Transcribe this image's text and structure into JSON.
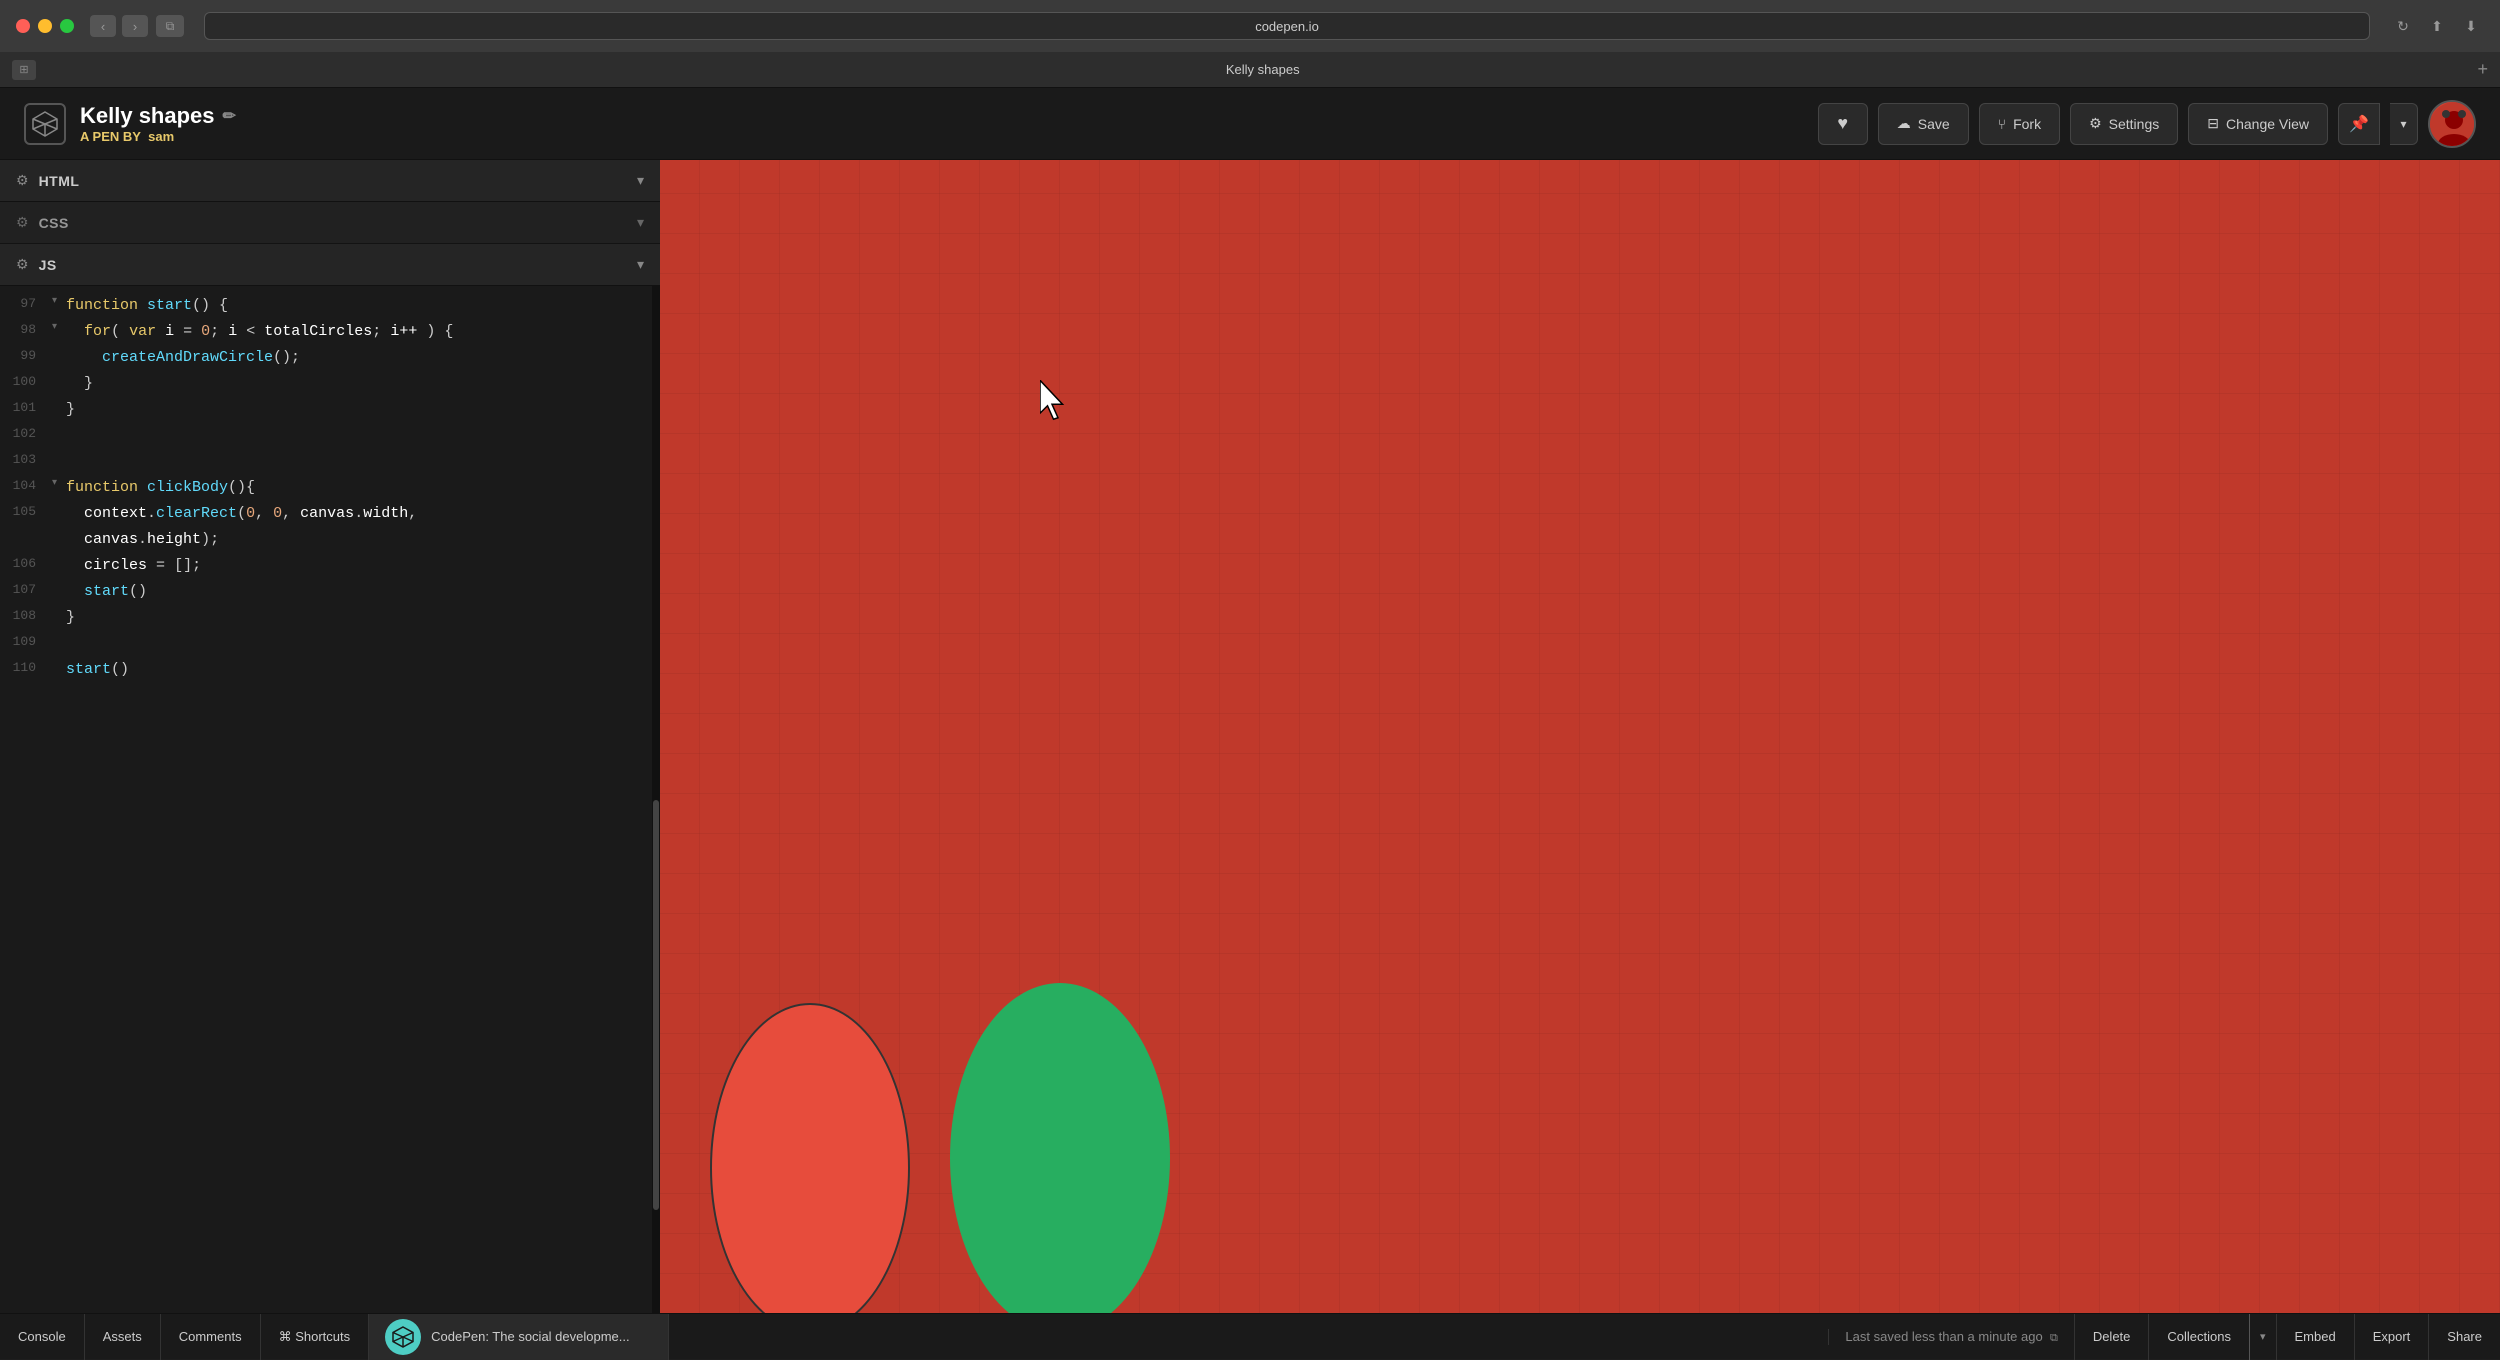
{
  "titlebar": {
    "url": "codepen.io",
    "tab_title": "Kelly shapes"
  },
  "header": {
    "pen_title": "Kelly shapes",
    "pen_subtitle": "A PEN BY",
    "pen_author": "sam",
    "heart_label": "♥",
    "save_label": "Save",
    "fork_label": "Fork",
    "settings_label": "Settings",
    "change_view_label": "Change View"
  },
  "editor": {
    "html_label": "HTML",
    "css_label": "CSS",
    "js_label": "JS",
    "lines": [
      {
        "num": "97",
        "content": "function start() {",
        "fold": "▾"
      },
      {
        "num": "98",
        "content": "  for( var i = 0; i < totalCircles; i++ ) {",
        "fold": "▾"
      },
      {
        "num": "99",
        "content": "    createAndDrawCircle();",
        "fold": ""
      },
      {
        "num": "100",
        "content": "  }",
        "fold": ""
      },
      {
        "num": "101",
        "content": "}",
        "fold": ""
      },
      {
        "num": "102",
        "content": "",
        "fold": ""
      },
      {
        "num": "103",
        "content": "",
        "fold": ""
      },
      {
        "num": "104",
        "content": "function clickBody(){",
        "fold": "▾"
      },
      {
        "num": "105",
        "content": "  context.clearRect(0, 0, canvas.width,",
        "fold": ""
      },
      {
        "num": "",
        "content": "  canvas.height);",
        "fold": ""
      },
      {
        "num": "106",
        "content": "  circles = [];",
        "fold": ""
      },
      {
        "num": "107",
        "content": "  start()",
        "fold": ""
      },
      {
        "num": "108",
        "content": "}",
        "fold": ""
      },
      {
        "num": "109",
        "content": "",
        "fold": ""
      },
      {
        "num": "110",
        "content": "start()",
        "fold": ""
      }
    ]
  },
  "bottombar": {
    "console_label": "Console",
    "assets_label": "Assets",
    "comments_label": "Comments",
    "shortcuts_label": "⌘ Shortcuts",
    "cp_title": "CodePen: The social developme...",
    "save_status": "Last saved less than a minute ago",
    "delete_label": "Delete",
    "collections_label": "Collections",
    "embed_label": "Embed",
    "export_label": "Export",
    "share_label": "Share"
  }
}
